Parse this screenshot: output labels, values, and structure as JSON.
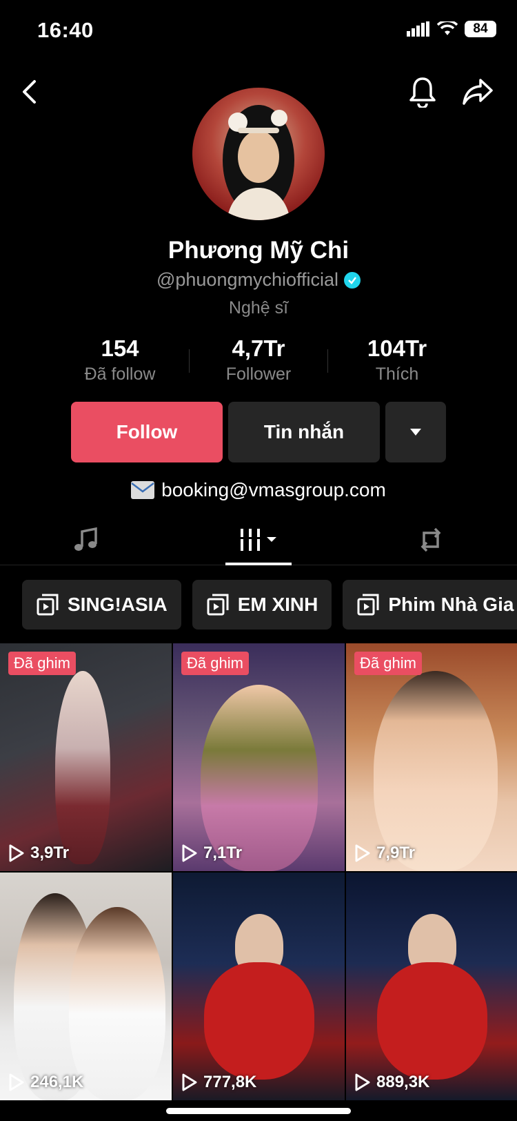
{
  "status_bar": {
    "time": "16:40",
    "battery": "84"
  },
  "profile": {
    "name": "Phương Mỹ Chi",
    "handle": "@phuongmychiofficial",
    "category": "Nghệ sĩ",
    "bio_email": "booking@vmasgroup.com"
  },
  "stats": [
    {
      "value": "154",
      "label": "Đã follow"
    },
    {
      "value": "4,7Tr",
      "label": "Follower"
    },
    {
      "value": "104Tr",
      "label": "Thích"
    }
  ],
  "buttons": {
    "follow": "Follow",
    "message": "Tin nhắn"
  },
  "playlists": [
    {
      "label": "SING!ASIA"
    },
    {
      "label": "EM XINH"
    },
    {
      "label": "Phim Nhà Gia Tiên"
    }
  ],
  "videos": [
    {
      "pinned": "Đã ghim",
      "views": "3,9Tr"
    },
    {
      "pinned": "Đã ghim",
      "views": "7,1Tr"
    },
    {
      "pinned": "Đã ghim",
      "views": "7,9Tr"
    },
    {
      "pinned": "",
      "views": "246,1K"
    },
    {
      "pinned": "",
      "views": "777,8K"
    },
    {
      "pinned": "",
      "views": "889,3K"
    }
  ],
  "colors": {
    "accent": "#ea4e62",
    "verified": "#20d5ec",
    "button_dark": "#262626"
  }
}
